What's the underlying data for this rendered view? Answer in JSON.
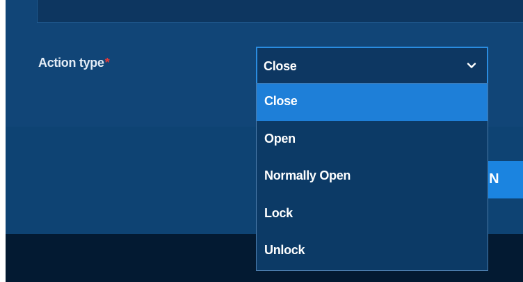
{
  "form": {
    "action_type_label": "Action type",
    "required_marker": "*"
  },
  "select": {
    "value": "Close",
    "icon": "chevron-down-icon",
    "options": [
      "Close",
      "Open",
      "Normally Open",
      "Lock",
      "Unlock"
    ],
    "selected_index": 0
  },
  "footer": {
    "button_label_visible": "nd N"
  },
  "colors": {
    "panel_bg": "#114577",
    "accent": "#1e7fd8",
    "select_border": "#2a8ce0",
    "required": "#e23a3a",
    "bottom_bar": "#031a32"
  }
}
